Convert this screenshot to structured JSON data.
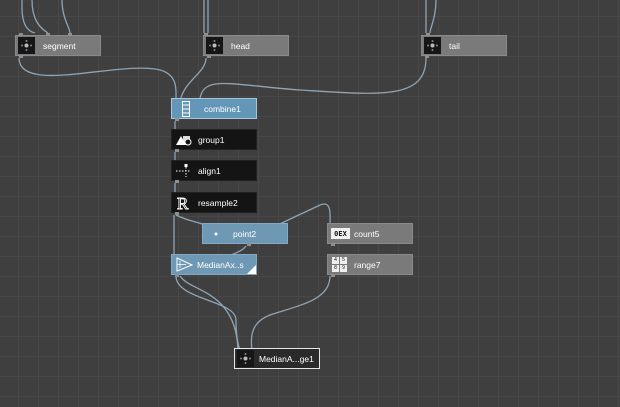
{
  "nodes": {
    "segment": "segment",
    "head": "head",
    "tail": "tail",
    "combine": "combine1",
    "group": "group1",
    "align": "align1",
    "resample": "resample2",
    "point": "point2",
    "count": "count5",
    "range": "range7",
    "median_axis": "MedianAx..s",
    "median_output": "MedianA...ge1"
  },
  "icons": {
    "segment": "network-node-icon",
    "head": "network-node-icon",
    "tail": "network-node-icon",
    "combine": "combine-icon",
    "group": "group-shapes-icon",
    "align": "align-icon",
    "resample": "resample-r-icon",
    "point": "point-icon",
    "count": "count-icon",
    "range": "range-grid-icon",
    "median_axis": "triangle-icon",
    "median_output": "network-node-icon"
  },
  "count_glyph": "0EX",
  "range_glyph": [
    "4",
    "5",
    "8",
    "9"
  ],
  "colors": {
    "canvas": "#3f3f3f",
    "grid": "#484848",
    "wire": "#8fa4b4",
    "node_gray": "#7a7a7a",
    "node_blue": "#6f98b4",
    "node_dark": "#141414",
    "node_text": "#ffffff"
  }
}
